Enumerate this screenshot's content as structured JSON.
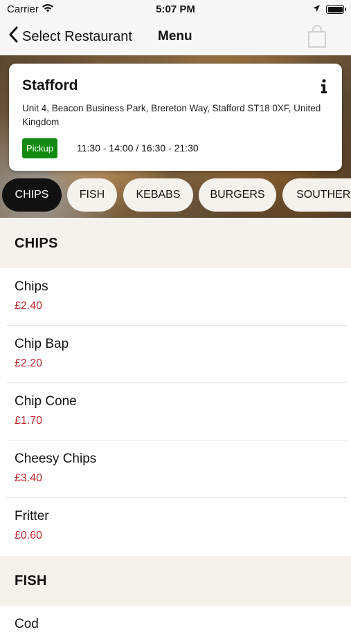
{
  "status_bar": {
    "carrier": "Carrier",
    "time": "5:07 PM"
  },
  "nav": {
    "back_label": "Select Restaurant",
    "title": "Menu",
    "bag_icon": "shopping-bag-icon"
  },
  "restaurant": {
    "name": "Stafford",
    "address": "Unit 4, Beacon Business Park, Brereton Way, Stafford ST18 0XF, United Kingdom",
    "pickup_label": "Pickup",
    "hours": "11:30 - 14:00 / 16:30 - 21:30",
    "pickup_color": "#128a12"
  },
  "categories": [
    {
      "label": "CHIPS",
      "active": true
    },
    {
      "label": "FISH",
      "active": false
    },
    {
      "label": "KEBABS",
      "active": false
    },
    {
      "label": "BURGERS",
      "active": false
    },
    {
      "label": "SOUTHERN",
      "active": false
    }
  ],
  "sections": [
    {
      "title": "CHIPS",
      "items": [
        {
          "name": "Chips",
          "price": "£2.40"
        },
        {
          "name": "Chip Bap",
          "price": "£2.20"
        },
        {
          "name": "Chip Cone",
          "price": "£1.70"
        },
        {
          "name": "Cheesy Chips",
          "price": "£3.40"
        },
        {
          "name": "Fritter",
          "price": "£0.60"
        }
      ]
    },
    {
      "title": "FISH",
      "items": [
        {
          "name": "Cod",
          "price": ""
        }
      ]
    }
  ],
  "colors": {
    "price": "#c0282e",
    "section_bg": "#f5f1ec",
    "active_pill": "#111111"
  }
}
